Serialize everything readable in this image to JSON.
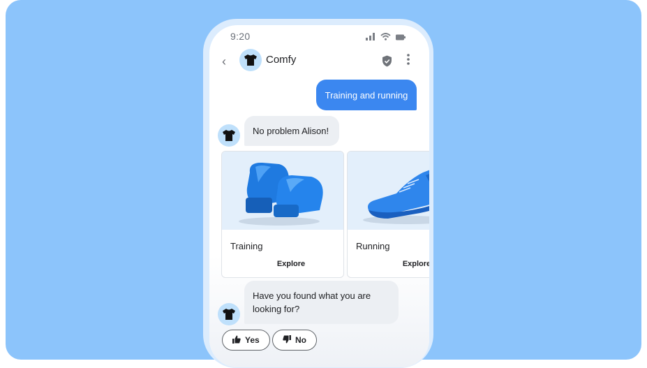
{
  "status_bar": {
    "time": "9:20",
    "icons": [
      "signal-icon",
      "wifi-icon",
      "battery-icon"
    ]
  },
  "header": {
    "title": "Comfy",
    "icons": [
      "back-arrow-icon",
      "tshirt-icon",
      "shield-check-icon",
      "more-vert-icon"
    ]
  },
  "conversation": {
    "user_message": "Training and running",
    "bot_reply_1": "No problem Alison!",
    "cards": [
      {
        "label": "Training",
        "cta": "Explore",
        "image": "boxing-gloves"
      },
      {
        "label": "Running",
        "cta": "Explore",
        "image": "running-shoe"
      }
    ],
    "bot_reply_2": "Have you found what you are looking for?",
    "quick_replies": [
      {
        "label": "Yes",
        "icon": "thumbs-up-icon"
      },
      {
        "label": "No",
        "icon": "thumbs-down-icon"
      }
    ]
  },
  "colors": {
    "background": "#8cc4fb",
    "user_bubble": "#3b87f0",
    "bot_bubble": "#eceff3",
    "avatar": "#bfe0fb"
  }
}
